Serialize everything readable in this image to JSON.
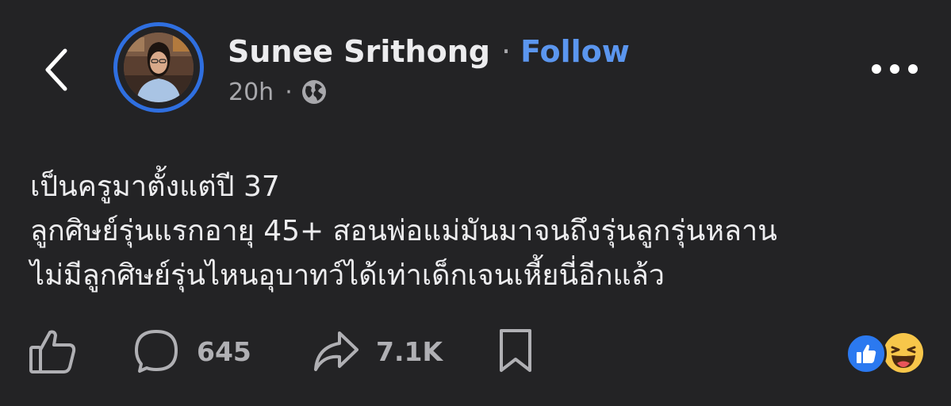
{
  "header": {
    "author_name": "Sunee Srithong",
    "separator": "·",
    "follow_label": "Follow",
    "time": "20h",
    "meta_separator": "·",
    "privacy_icon": "globe-icon",
    "back_icon": "chevron-left-icon",
    "more_icon": "more-horizontal-icon"
  },
  "post": {
    "lines": [
      "เป็นครูมาตั้งแต่ปี 37",
      "ลูกศิษย์รุ่นแรกอายุ 45+ สอนพ่อแม่มันมาจนถึงรุ่นลูกรุ่นหลาน",
      "ไม่มีลูกศิษย์รุ่นไหนอุบาทว์ได้เท่าเด็กเจนเหี้ยนี่อีกแล้ว"
    ]
  },
  "actions": {
    "like_icon": "thumbs-up-icon",
    "comment_icon": "comment-icon",
    "comment_count": "645",
    "share_icon": "share-icon",
    "share_count": "7.1K",
    "save_icon": "bookmark-icon",
    "reactions": [
      "like",
      "haha"
    ]
  },
  "colors": {
    "background": "#232325",
    "text": "#ececee",
    "secondary_text": "#a8a8ac",
    "link": "#5b96ef",
    "avatar_ring": "#2f6fe0",
    "like_reaction": "#2b79f0",
    "haha_reaction": "#f7c64a"
  }
}
